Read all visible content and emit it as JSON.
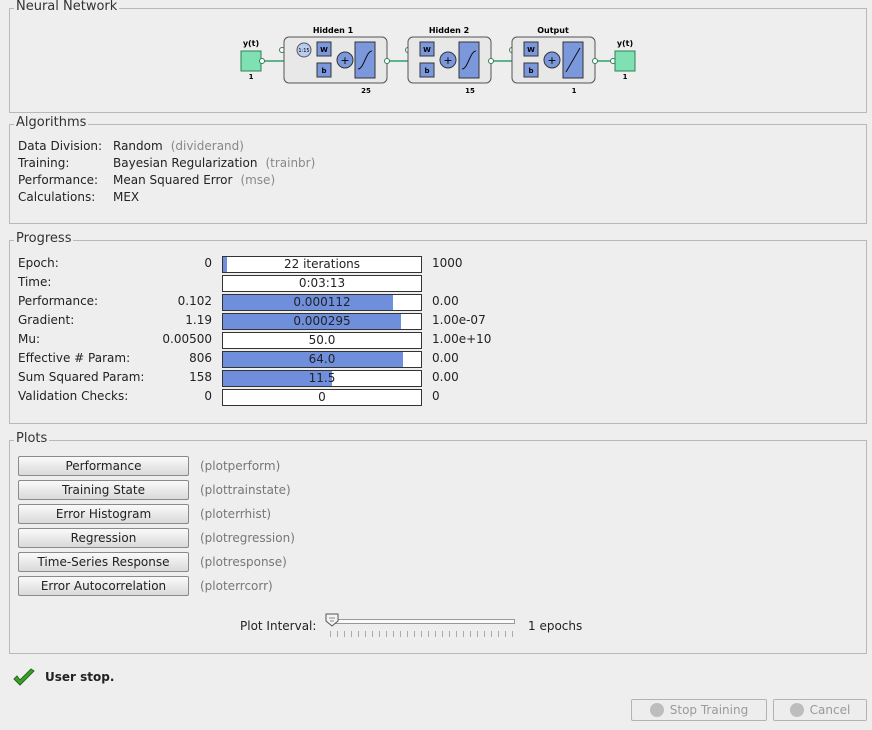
{
  "network": {
    "title": "Neural Network",
    "input_label": "y(t)",
    "input_size": "1",
    "hidden1_title": "Hidden 1",
    "hidden1_size": "25",
    "hidden2_title": "Hidden 2",
    "hidden2_size": "15",
    "output_title": "Output",
    "output_size": "1",
    "output_label": "y(t)",
    "output_dim": "1",
    "delay_label": "1:15",
    "weight_label": "W",
    "bias_label": "b"
  },
  "algorithms": {
    "title": "Algorithms",
    "rows": [
      {
        "label": "Data Division:",
        "value": "Random",
        "fn": "(dividerand)"
      },
      {
        "label": "Training:",
        "value": "Bayesian Regularization",
        "fn": "(trainbr)"
      },
      {
        "label": "Performance:",
        "value": "Mean Squared Error",
        "fn": "(mse)"
      },
      {
        "label": "Calculations:",
        "value": "MEX",
        "fn": ""
      }
    ]
  },
  "progress": {
    "title": "Progress",
    "rows": [
      {
        "label": "Epoch:",
        "start": "0",
        "bar_text": "22 iterations",
        "end": "1000",
        "fill": 0.022
      },
      {
        "label": "Time:",
        "start": "",
        "bar_text": "0:03:13",
        "end": "",
        "fill": 0
      },
      {
        "label": "Performance:",
        "start": "0.102",
        "bar_text": "0.000112",
        "end": "0.00",
        "fill": 0.86
      },
      {
        "label": "Gradient:",
        "start": "1.19",
        "bar_text": "0.000295",
        "end": "1.00e-07",
        "fill": 0.9
      },
      {
        "label": "Mu:",
        "start": "0.00500",
        "bar_text": "50.0",
        "end": "1.00e+10",
        "fill": 0
      },
      {
        "label": "Effective # Param:",
        "start": "806",
        "bar_text": "64.0",
        "end": "0.00",
        "fill": 0.91
      },
      {
        "label": "Sum Squared Param:",
        "start": "158",
        "bar_text": "11.5",
        "end": "0.00",
        "fill": 0.55
      },
      {
        "label": "Validation Checks:",
        "start": "0",
        "bar_text": "0",
        "end": "0",
        "fill": 0
      }
    ]
  },
  "plots": {
    "title": "Plots",
    "buttons": [
      {
        "label": "Performance",
        "fn": "(plotperform)"
      },
      {
        "label": "Training State",
        "fn": "(plottrainstate)"
      },
      {
        "label": "Error Histogram",
        "fn": "(ploterrhist)"
      },
      {
        "label": "Regression",
        "fn": "(plotregression)"
      },
      {
        "label": "Time-Series Response",
        "fn": "(plotresponse)"
      },
      {
        "label": "Error Autocorrelation",
        "fn": "(ploterrcorr)"
      }
    ],
    "interval_label": "Plot Interval:",
    "interval_value": "1 epochs",
    "interval_slider_value": 1
  },
  "status": {
    "text": "User stop."
  },
  "footer": {
    "stop_label": "Stop Training",
    "cancel_label": "Cancel"
  },
  "colors": {
    "bar_fill": "#6f8fdc",
    "block_blue": "#7b98dc",
    "io_green": "#7fe0b1",
    "check_green": "#3aa02a"
  }
}
